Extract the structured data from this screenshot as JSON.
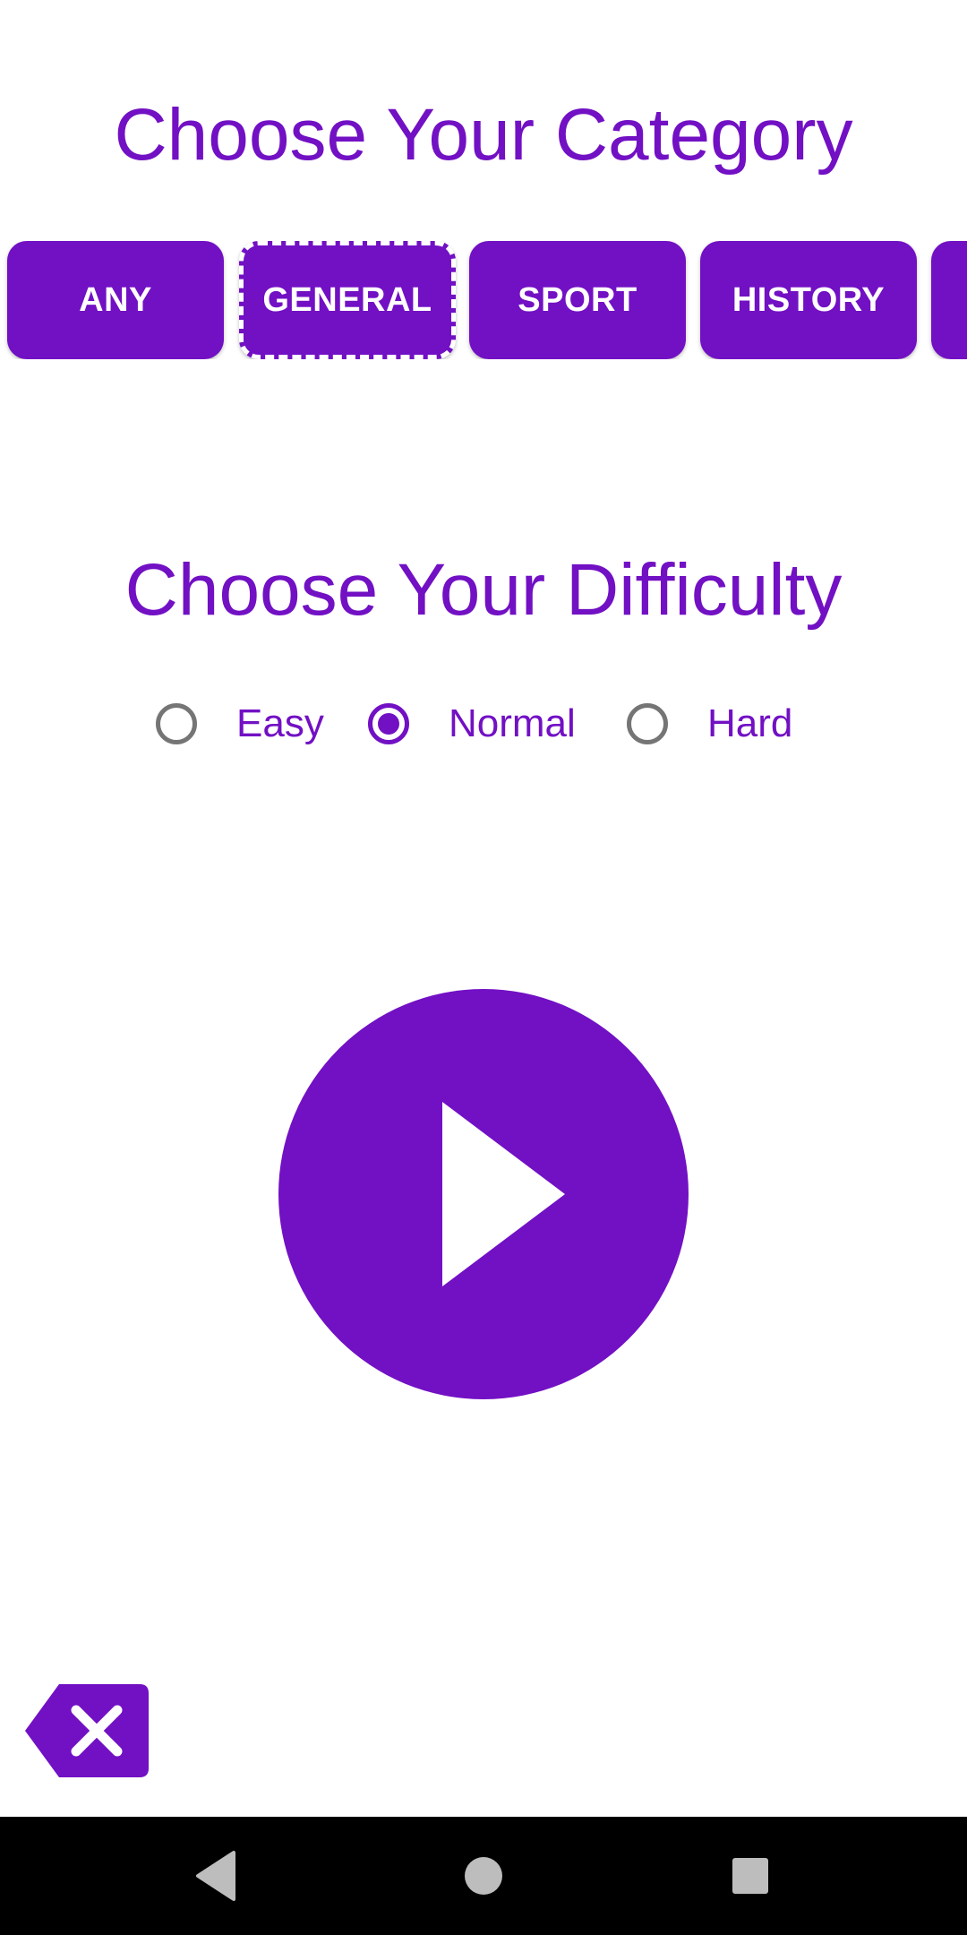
{
  "category": {
    "title": "Choose Your Category",
    "options": [
      {
        "label": "ANY"
      },
      {
        "label": "GENERAL",
        "focused": true
      },
      {
        "label": "SPORT"
      },
      {
        "label": "HISTORY"
      }
    ]
  },
  "difficulty": {
    "title": "Choose Your Difficulty",
    "options": [
      {
        "label": "Easy",
        "checked": false
      },
      {
        "label": "Normal",
        "checked": true
      },
      {
        "label": "Hard",
        "checked": false
      }
    ],
    "selected": "Normal"
  },
  "icons": {
    "play": "play-icon",
    "clear": "backspace-clear-icon",
    "nav_back": "back-triangle-icon",
    "nav_home": "home-circle-icon",
    "nav_recents": "recents-square-icon"
  },
  "colors": {
    "accent": "#7210c4",
    "background": "#ffffff",
    "radio_unchecked": "#757575",
    "nav_bar": "#000000",
    "nav_icons": "#bdbdbd"
  }
}
